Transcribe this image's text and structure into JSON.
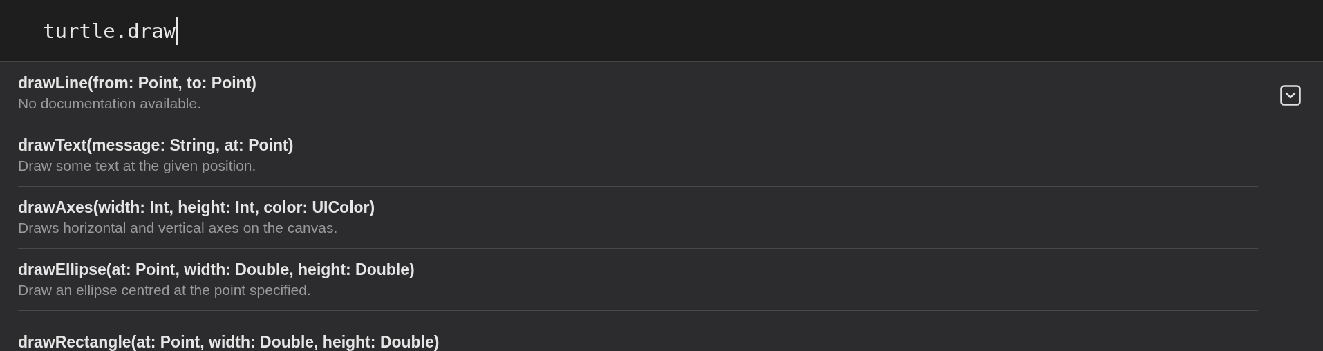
{
  "editor": {
    "code": "turtle.draw"
  },
  "completions": [
    {
      "signature": "drawLine(from: Point, to: Point)",
      "description": "No documentation available."
    },
    {
      "signature": "drawText(message: String, at: Point)",
      "description": "Draw some text at the given position."
    },
    {
      "signature": "drawAxes(width: Int, height: Int, color: UIColor)",
      "description": "Draws horizontal and vertical axes on the canvas."
    },
    {
      "signature": "drawEllipse(at: Point, width: Double, height: Double)",
      "description": "Draw an ellipse centred at the point specified."
    },
    {
      "signature": "drawRectangle(at: Point, width: Double, height: Double)"
    }
  ]
}
